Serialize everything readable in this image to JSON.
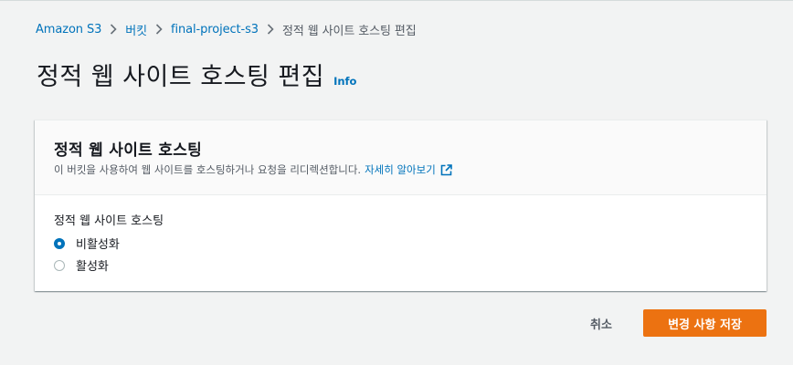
{
  "breadcrumb": {
    "items": [
      "Amazon S3",
      "버킷",
      "final-project-s3"
    ],
    "current": "정적 웹 사이트 호스팅 편집"
  },
  "header": {
    "title": "정적 웹 사이트 호스팅 편집",
    "info_label": "Info"
  },
  "panel": {
    "title": "정적 웹 사이트 호스팅",
    "description": "이 버킷을 사용하여 웹 사이트를 호스팅하거나 요청을 리디렉션합니다.",
    "learn_more": "자세히 알아보기",
    "field_label": "정적 웹 사이트 호스팅",
    "options": [
      {
        "label": "비활성화",
        "selected": true
      },
      {
        "label": "활성화",
        "selected": false
      }
    ]
  },
  "actions": {
    "cancel_label": "취소",
    "save_label": "변경 사항 저장"
  },
  "colors": {
    "link": "#0073bb",
    "primary_button": "#ec7211",
    "background": "#f2f3f3"
  }
}
